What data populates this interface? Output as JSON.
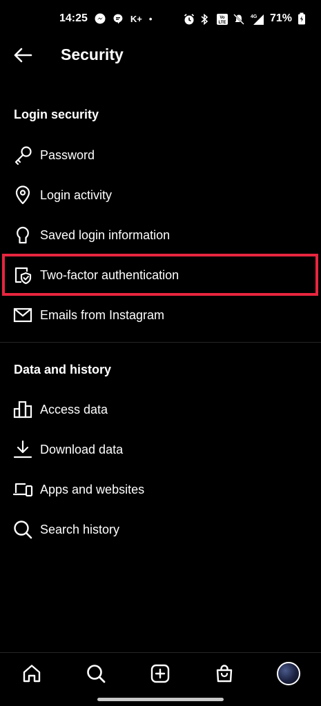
{
  "status_bar": {
    "time": "14:25",
    "k_label": "K+",
    "dot": "•",
    "network": "4G",
    "battery": "71%",
    "icons": [
      "messenger-icon",
      "chat-bubble-icon",
      "alarm-icon",
      "bluetooth-icon",
      "volte-icon",
      "mute-icon",
      "signal-icon",
      "battery-icon"
    ]
  },
  "header": {
    "title": "Security",
    "back_icon": "arrow-left-icon"
  },
  "sections": {
    "login_security": {
      "title": "Login security",
      "items": [
        {
          "label": "Password",
          "icon": "key-icon"
        },
        {
          "label": "Login activity",
          "icon": "location-pin-icon"
        },
        {
          "label": "Saved login information",
          "icon": "keyhole-icon"
        },
        {
          "label": "Two-factor authentication",
          "icon": "shield-check-icon"
        },
        {
          "label": "Emails from Instagram",
          "icon": "mail-icon"
        }
      ]
    },
    "data_history": {
      "title": "Data and history",
      "items": [
        {
          "label": "Access data",
          "icon": "bar-chart-icon"
        },
        {
          "label": "Download data",
          "icon": "download-icon"
        },
        {
          "label": "Apps and websites",
          "icon": "devices-icon"
        },
        {
          "label": "Search history",
          "icon": "search-icon"
        }
      ]
    }
  },
  "highlight_color": "#e8253f",
  "bottom_nav": [
    "home-icon",
    "search-icon",
    "add-icon",
    "shop-icon",
    "profile-avatar"
  ]
}
